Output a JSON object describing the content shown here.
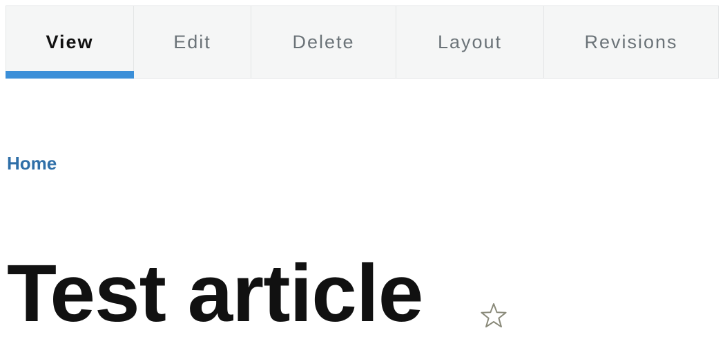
{
  "tabs": [
    {
      "label": "View",
      "active": true
    },
    {
      "label": "Edit",
      "active": false
    },
    {
      "label": "Delete",
      "active": false
    },
    {
      "label": "Layout",
      "active": false
    },
    {
      "label": "Revisions",
      "active": false
    }
  ],
  "breadcrumb": {
    "home_label": "Home"
  },
  "page": {
    "title": "Test article"
  },
  "colors": {
    "active_tab_indicator": "#3b8fd8",
    "breadcrumb_link": "#2f6fa8",
    "tab_background": "#f5f6f6",
    "star_outline": "#8a8a7a"
  },
  "icons": {
    "favorite": "star-outline-icon"
  }
}
